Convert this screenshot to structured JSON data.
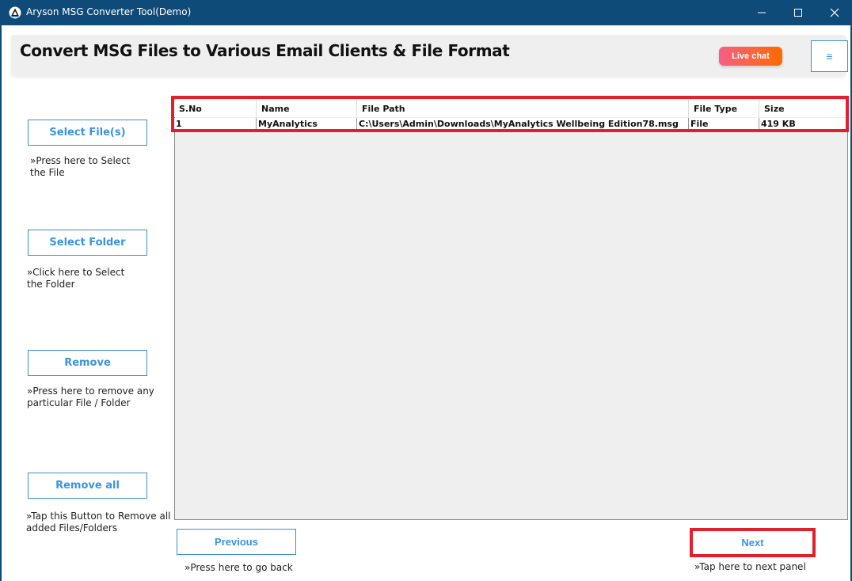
{
  "window": {
    "title": "Aryson MSG Converter Tool(Demo)",
    "controls": {
      "minimize": "minimize",
      "maximize": "maximize",
      "close": "close"
    }
  },
  "header": {
    "title": "Convert MSG Files to Various Email Clients & File Format",
    "live_chat_label": "Live chat",
    "menu_icon": "≡"
  },
  "sidebar": {
    "select_files": {
      "label": "Select File(s)",
      "hint_line1": "»Press here to Select",
      "hint_line2": "the File"
    },
    "select_folder": {
      "label": "Select Folder",
      "hint_line1": "»Click here to Select",
      "hint_line2": "the Folder"
    },
    "remove": {
      "label": "Remove",
      "hint_line1": "»Press here to remove any",
      "hint_line2": "particular File / Folder"
    },
    "remove_all": {
      "label": "Remove all",
      "hint_line1": "»Tap this Button to Remove all",
      "hint_line2": "added Files/Folders"
    }
  },
  "table": {
    "columns": [
      "S.No",
      "Name",
      "File Path",
      "File Type",
      "Size"
    ],
    "rows": [
      [
        "1",
        "MyAnalytics",
        "C:\\Users\\Admin\\Downloads\\MyAnalytics Wellbeing Edition78.msg",
        "File",
        "419 KB"
      ]
    ]
  },
  "footer": {
    "previous": {
      "label": "Previous",
      "hint": "»Press here to go back"
    },
    "next": {
      "label": "Next",
      "hint": "»Tap here to next panel"
    }
  },
  "colors": {
    "titlebar": "#0e4b78",
    "button_text": "#3b93e0",
    "highlight": "#e0202c",
    "live_chat_start": "#f55f87",
    "live_chat_end": "#ff6a00"
  }
}
